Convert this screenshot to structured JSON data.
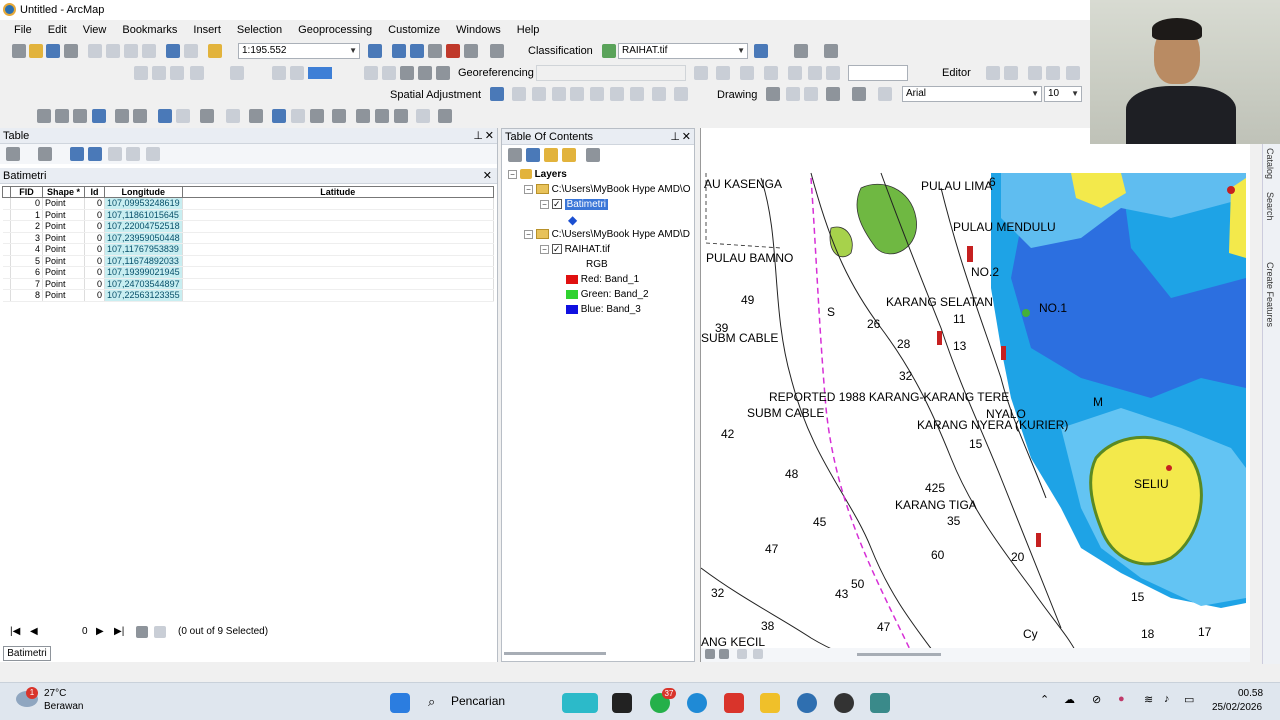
{
  "window": {
    "title": "Untitled - ArcMap"
  },
  "menu": [
    "File",
    "Edit",
    "View",
    "Bookmarks",
    "Insert",
    "Selection",
    "Geoprocessing",
    "Customize",
    "Windows",
    "Help"
  ],
  "toolbar": {
    "scale": "1:195.552",
    "classification_label": "Classification",
    "raster_layer": "RAIHAT.tif",
    "georeferencing_label": "Georeferencing",
    "editor_label": "Editor",
    "spatial_adjustment_label": "Spatial Adjustment",
    "drawing_label": "Drawing",
    "font_name": "Arial",
    "font_size": "10"
  },
  "table_pane": {
    "title": "Table",
    "table_name": "Batimetri",
    "columns": [
      "FID",
      "Shape *",
      "Id",
      "Longitude",
      "Latitude"
    ],
    "rows": [
      [
        "0",
        "Point",
        "0",
        "107,09953248619",
        ""
      ],
      [
        "1",
        "Point",
        "0",
        "107,11861015645",
        ""
      ],
      [
        "2",
        "Point",
        "0",
        "107,22004752518",
        ""
      ],
      [
        "3",
        "Point",
        "0",
        "107,23959050448",
        ""
      ],
      [
        "4",
        "Point",
        "0",
        "107,11767953839",
        ""
      ],
      [
        "5",
        "Point",
        "0",
        "107,11674892033",
        ""
      ],
      [
        "6",
        "Point",
        "0",
        "107,19399021945",
        ""
      ],
      [
        "7",
        "Point",
        "0",
        "107,24703544897",
        ""
      ],
      [
        "8",
        "Point",
        "0",
        "107,22563123355",
        ""
      ]
    ],
    "record_position": "0",
    "selection_status": "(0 out of 9 Selected)",
    "bottom_tab": "Batimetri"
  },
  "toc": {
    "title": "Table Of Contents",
    "root": "Layers",
    "group1_path": "C:\\Users\\MyBook Hype AMD\\O",
    "layer1": "Batimetri",
    "group2_path": "C:\\Users\\MyBook Hype AMD\\D",
    "layer2": "RAIHAT.tif",
    "rgb_label": "RGB",
    "bands": [
      {
        "label": "Red:",
        "band": "Band_1",
        "color": "#e01010"
      },
      {
        "label": "Green:",
        "band": "Band_2",
        "color": "#2fd22f"
      },
      {
        "label": "Blue:",
        "band": "Band_3",
        "color": "#1010e0"
      }
    ]
  },
  "map": {
    "labels": [
      "AU KASENGA",
      "PULAU LIMA",
      "6",
      "PULAU MENDULU",
      "PULAU BAMNO",
      "KARANG SELATAN",
      "NO.1",
      "NO.2",
      "SUBM CABLE",
      "REPORTED 1988 KARANG-KARANG TERE",
      "NYALO",
      "SUBM CABLE",
      "KARANG NYERA (KURIER)",
      "KARANG TIGA",
      "SELIU",
      "ANG KECIL",
      "49",
      "39",
      "42",
      "48",
      "45",
      "47",
      "32",
      "38",
      "43",
      "50",
      "47",
      "60",
      "20",
      "15",
      "18",
      "17",
      "35",
      "425",
      "13",
      "11",
      "28",
      "32",
      "26",
      "15",
      "Cy",
      "M",
      "S"
    ]
  },
  "side_panel": [
    "Catalog",
    "Search",
    "Create Features"
  ],
  "taskbar": {
    "weather_temp": "27°C",
    "weather_desc": "Berawan",
    "weather_badge": "1",
    "search_placeholder": "Pencarian",
    "whatsapp_badge": "37",
    "time": "00.58",
    "date": "25/02/2026"
  }
}
